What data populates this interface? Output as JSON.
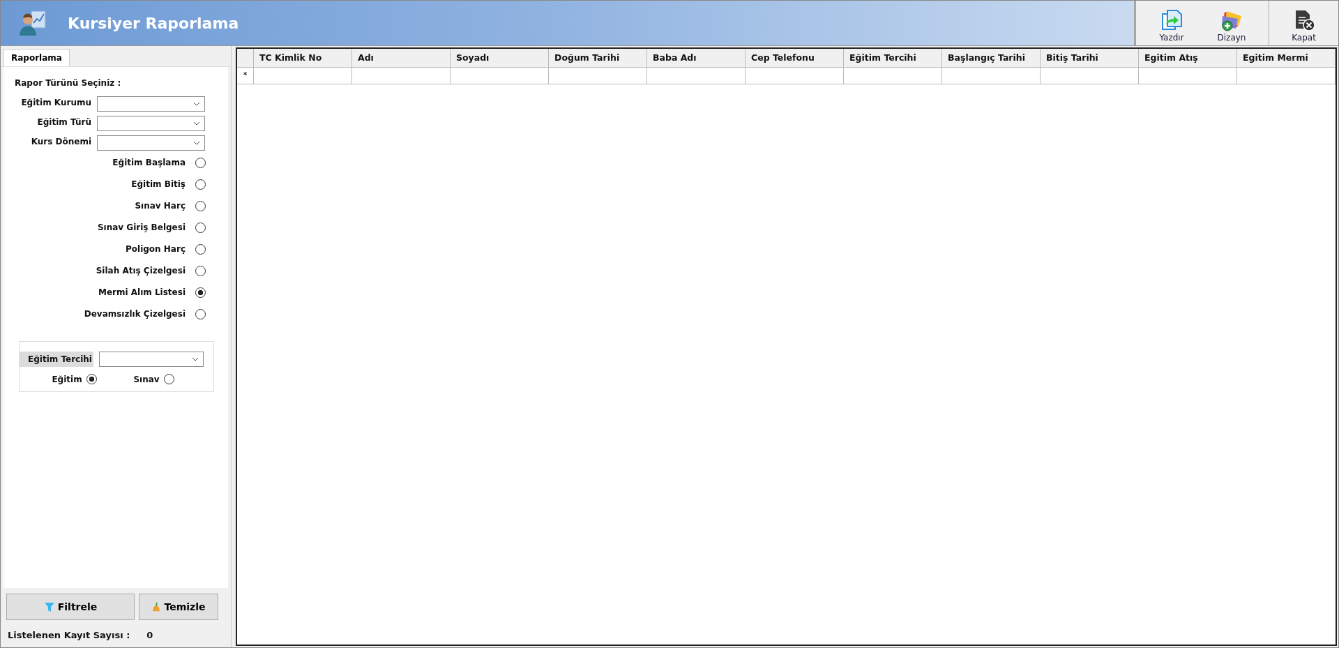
{
  "window": {
    "title": "Kursiyer Raporlama"
  },
  "toolbar": [
    {
      "label": "Yazdır",
      "kind": "print"
    },
    {
      "label": "Dizayn",
      "kind": "design"
    },
    {
      "label": "Kapat",
      "kind": "close"
    }
  ],
  "tabs": [
    {
      "label": "Raporlama",
      "selected": true
    }
  ],
  "panel": {
    "heading": "Rapor Türünü Seçiniz :",
    "combos": [
      {
        "label": "Eğitim Kurumu"
      },
      {
        "label": "Eğitim Türü"
      },
      {
        "label": "Kurs Dönemi"
      }
    ],
    "report_types": [
      {
        "label": "Eğitim Başlama",
        "selected": false
      },
      {
        "label": "Eğitim Bitiş",
        "selected": false
      },
      {
        "label": "Sınav Harç",
        "selected": false
      },
      {
        "label": "Sınav Giriş Belgesi",
        "selected": false
      },
      {
        "label": "Poligon Harç",
        "selected": false
      },
      {
        "label": "Silah Atış Çizelgesi",
        "selected": false
      },
      {
        "label": "Mermi Alım Listesi",
        "selected": true
      },
      {
        "label": "Devamsızlık Çizelgesi",
        "selected": false
      }
    ],
    "group": {
      "combo_label": "Eğitim Tercihi",
      "options": [
        {
          "label": "Eğitim",
          "selected": true
        },
        {
          "label": "Sınav",
          "selected": false
        }
      ]
    },
    "buttons": [
      {
        "label": "Filtrele",
        "kind": "filter"
      },
      {
        "label": "Temizle",
        "kind": "clear"
      }
    ],
    "count_label": "Listelenen Kayıt Sayısı :",
    "count_value": "0"
  },
  "table": {
    "columns": [
      "TC Kimlik No",
      "Adı",
      "Soyadı",
      "Doğum Tarihi",
      "Baba Adı",
      "Cep Telefonu",
      "Eğitim Tercihi",
      "Başlangıç Tarihi",
      "Bitiş Tarihi",
      "Egitim Atış",
      "Egitim Mermi"
    ],
    "new_row_marker": "*"
  }
}
